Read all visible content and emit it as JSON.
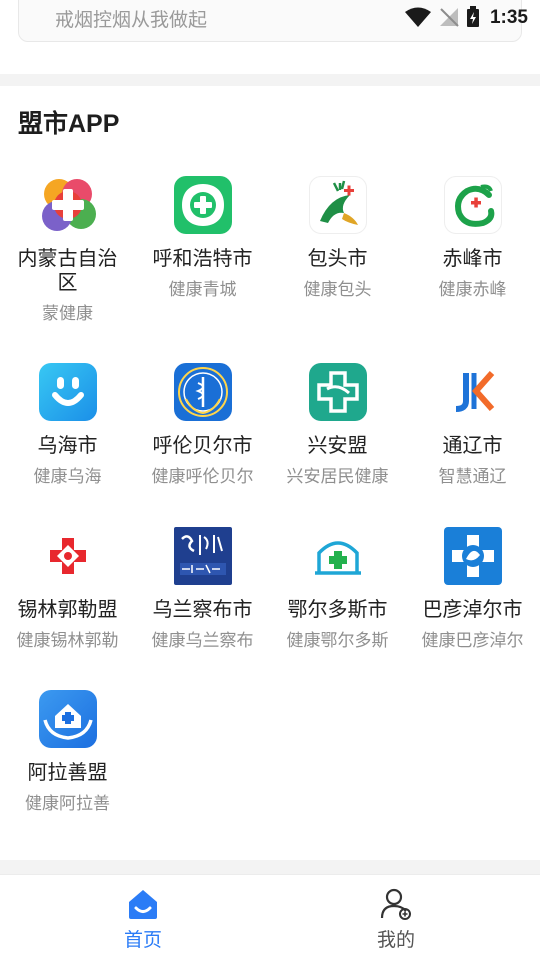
{
  "status_bar": {
    "time": "1:35"
  },
  "search": {
    "placeholder": "戒烟控烟从我做起"
  },
  "section": {
    "title": "盟市APP"
  },
  "apps": [
    {
      "name": "内蒙古自治区",
      "sub": "蒙健康",
      "icon": "colorful-cross-icon"
    },
    {
      "name": "呼和浩特市",
      "sub": "健康青城",
      "icon": "green-cross-icon"
    },
    {
      "name": "包头市",
      "sub": "健康包头",
      "icon": "deer-icon"
    },
    {
      "name": "赤峰市",
      "sub": "健康赤峰",
      "icon": "green-c-icon"
    },
    {
      "name": "乌海市",
      "sub": "健康乌海",
      "icon": "smile-u-icon"
    },
    {
      "name": "呼伦贝尔市",
      "sub": "健康呼伦贝尔",
      "icon": "medical-emblem-icon"
    },
    {
      "name": "兴安盟",
      "sub": "兴安居民健康",
      "icon": "teal-cross-icon"
    },
    {
      "name": "通辽市",
      "sub": "智慧通辽",
      "icon": "jk-logo-icon"
    },
    {
      "name": "锡林郭勒盟",
      "sub": "健康锡林郭勒",
      "icon": "red-cross-icon"
    },
    {
      "name": "乌兰察布市",
      "sub": "健康乌兰察布",
      "icon": "calligraphy-icon"
    },
    {
      "name": "鄂尔多斯市",
      "sub": "健康鄂尔多斯",
      "icon": "house-cross-icon"
    },
    {
      "name": "巴彦淖尔市",
      "sub": "健康巴彦淖尔",
      "icon": "blue-emblem-icon"
    },
    {
      "name": "阿拉善盟",
      "sub": "健康阿拉善",
      "icon": "hands-house-icon"
    }
  ],
  "tabs": [
    {
      "label": "首页",
      "icon": "home-icon",
      "active": true
    },
    {
      "label": "我的",
      "icon": "user-icon",
      "active": false
    }
  ],
  "colors": {
    "accent": "#2b7cf6",
    "subtext": "#8f8f8f"
  }
}
